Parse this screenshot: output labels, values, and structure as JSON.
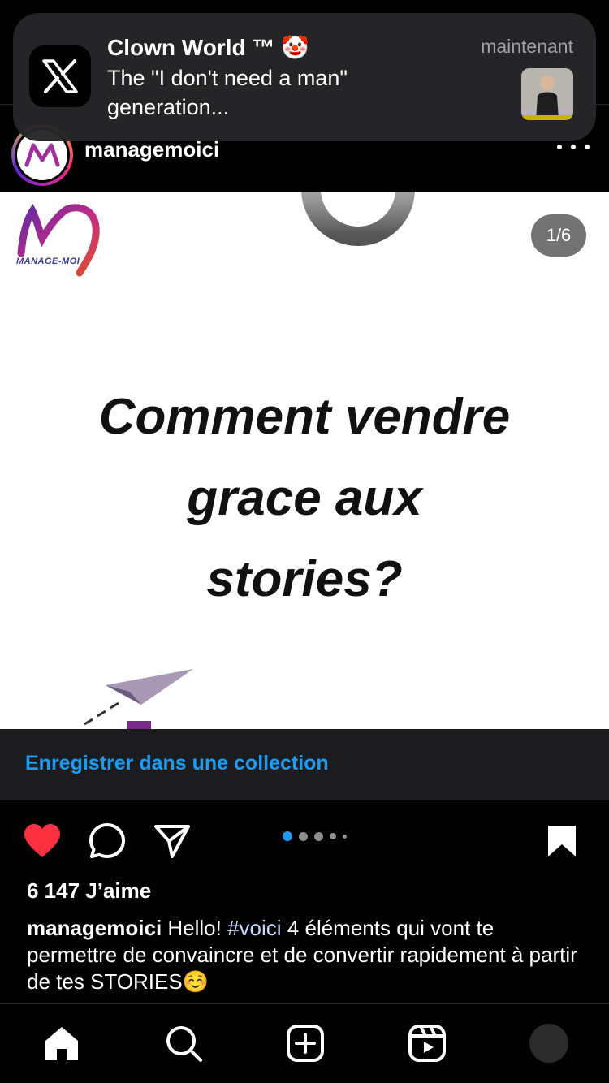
{
  "notification": {
    "app_icon": "x-logo-icon",
    "title": "Clown World ™",
    "title_emoji": "🤡",
    "body": "The \"I don't need a man\" generation...",
    "time": "maintenant"
  },
  "post": {
    "username": "managemoici",
    "image": {
      "brand_caption": "MANAGE-MOI",
      "counter": "1/6",
      "headline_line1": "Comment vendre",
      "headline_line2": "grace aux",
      "headline_line3": "stories?"
    },
    "save_collection_label": "Enregistrer dans une collection",
    "carousel": {
      "total": 5,
      "active_index": 0
    },
    "likes": "6 147 J’aime",
    "caption": {
      "username": "managemoici",
      "text_before": " Hello! ",
      "hashtag": "#voici",
      "text_after": " 4 éléments qui vont te permettre de convaincre et de convertir rapidement à partir de tes STORIES☺️"
    },
    "liked": true,
    "saved": true
  },
  "tabbar": {
    "items": [
      "home-icon",
      "search-icon",
      "create-icon",
      "reels-icon",
      "profile-icon"
    ]
  },
  "colors": {
    "like_red": "#ff3040",
    "link_blue": "#1d9bf0",
    "background": "#000000"
  }
}
